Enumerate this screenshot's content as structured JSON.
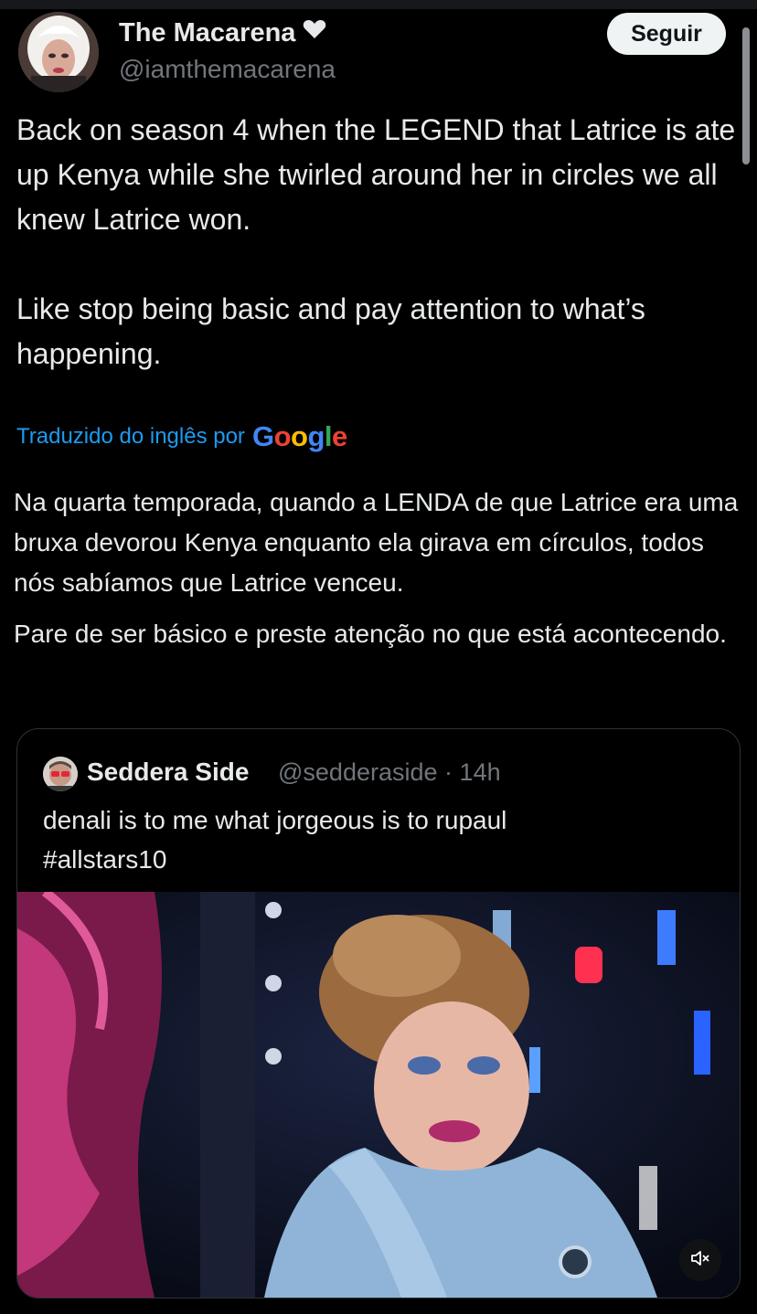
{
  "author": {
    "display_name": "The Macarena",
    "handle": "@iamthemacarena",
    "verified_icon": "heart-icon"
  },
  "follow_label": "Seguir",
  "tweet": {
    "text": "Back on season 4 when the LEGEND that Latrice is ate up Kenya while she twirled around  her in circles we all knew Latrice won.\n\nLike stop being basic and pay attention to what’s happening."
  },
  "translation": {
    "label": "Traduzido do inglês por",
    "provider": "Google",
    "paragraphs": [
      "Na quarta temporada, quando a LENDA de que Latrice era uma bruxa devorou Kenya enquanto ela girava em círculos, todos nós sabíamos que Latrice venceu.",
      "Pare de ser básico e preste atenção no que está acontecendo."
    ]
  },
  "quoted": {
    "display_name": "Seddera Side",
    "handle": "@sedderaside",
    "separator": "·",
    "time": "14h",
    "text_lines": [
      "denali is to me what jorgeous is to rupaul",
      "#allstars10"
    ],
    "media_icon": "mute-icon"
  },
  "colors": {
    "background": "#000000",
    "text": "#e7e9ea",
    "secondary": "#71767b",
    "link": "#1d9bf0",
    "follow_bg": "#eff3f4"
  }
}
